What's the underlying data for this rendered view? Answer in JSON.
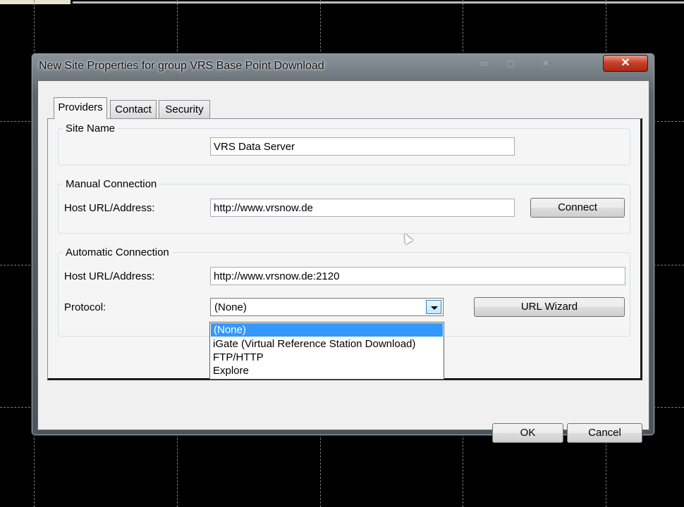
{
  "window": {
    "title": "New Site Properties for group VRS Base Point Download",
    "close_label": "✕",
    "minimize_label": "▭",
    "maximize_label": "▢"
  },
  "tabs": [
    {
      "label": "Providers"
    },
    {
      "label": "Contact"
    },
    {
      "label": "Security"
    }
  ],
  "site_name": {
    "legend": "Site Name",
    "value": "VRS Data Server"
  },
  "manual_connection": {
    "legend": "Manual Connection",
    "host_label": "Host URL/Address:",
    "host_value": "http://www.vrsnow.de",
    "connect_label": "Connect"
  },
  "automatic_connection": {
    "legend": "Automatic Connection",
    "host_label": "Host URL/Address:",
    "host_value": "http://www.vrsnow.de:2120",
    "protocol_label": "Protocol:",
    "protocol_value": "(None)",
    "url_wizard_label": "URL Wizard",
    "protocol_options": [
      "(None)",
      "iGate (Virtual Reference Station Download)",
      "FTP/HTTP",
      "Explore"
    ]
  },
  "footer": {
    "ok_label": "OK",
    "cancel_label": "Cancel"
  },
  "icons": {
    "dropdown": "chevron-down-icon",
    "cursor": "mouse-cursor-icon"
  }
}
